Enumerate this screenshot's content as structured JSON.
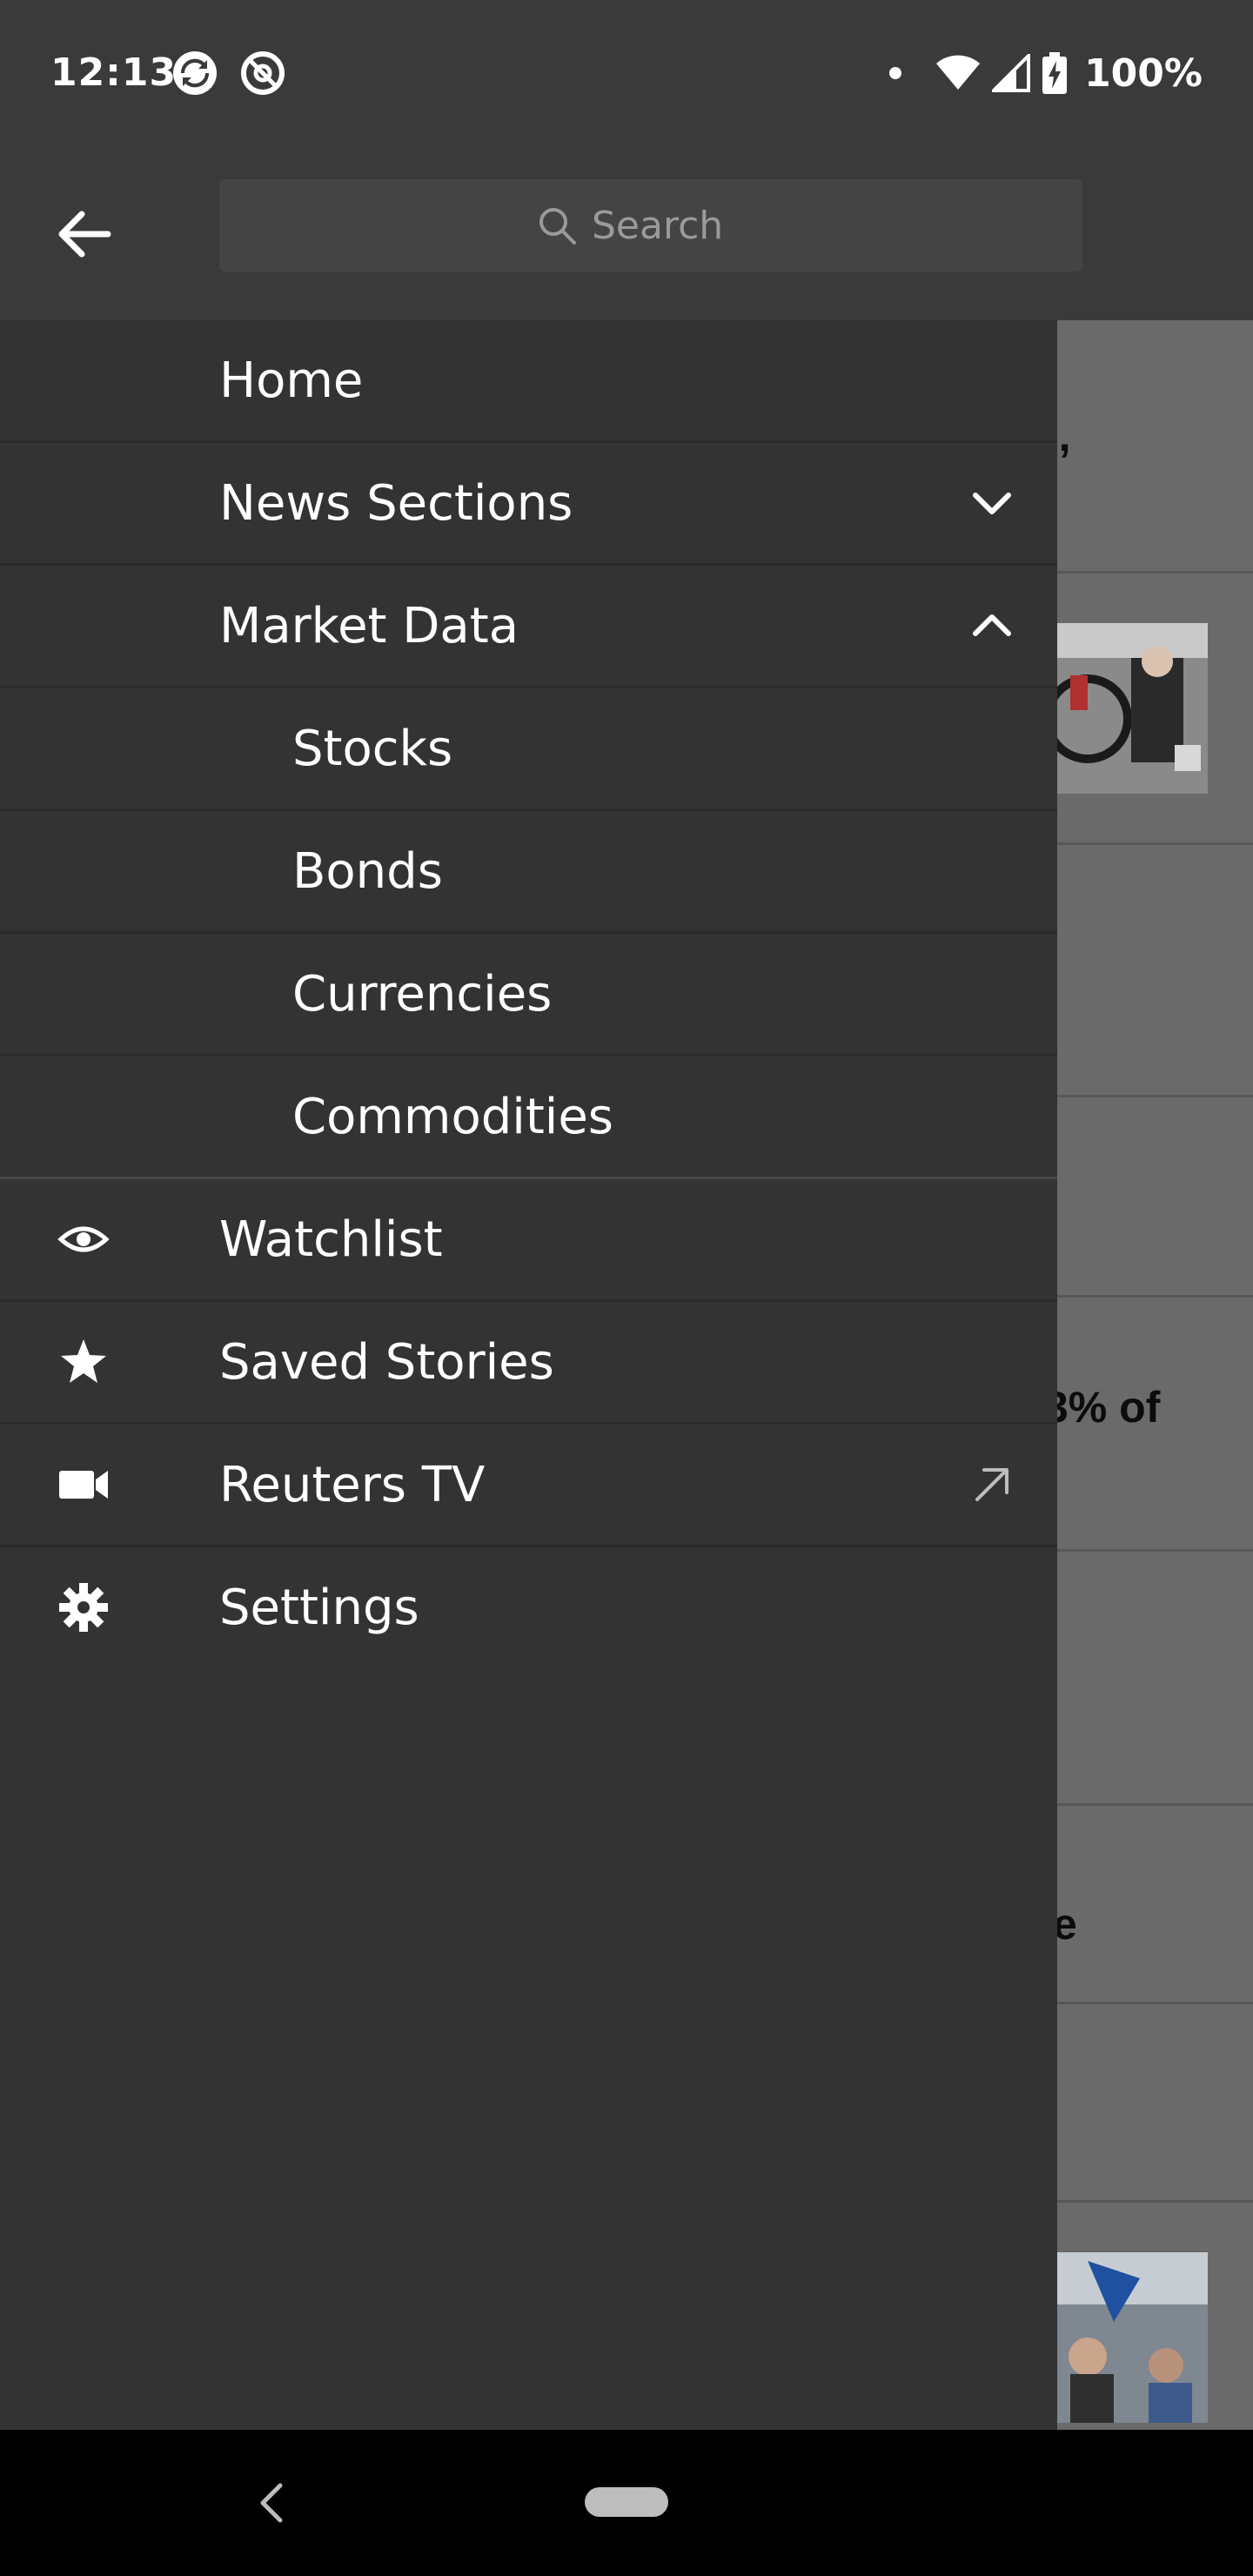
{
  "status_bar": {
    "time": "12:13",
    "battery": "100%",
    "icons": [
      "sync-app-icon",
      "at-sign-app-icon",
      "notification-dot",
      "wifi-icon",
      "signal-icon",
      "battery-charging-icon"
    ]
  },
  "search": {
    "placeholder": "Search"
  },
  "menu": {
    "home": "Home",
    "news_sections": "News Sections",
    "market_data": "Market Data",
    "stocks": "Stocks",
    "bonds": "Bonds",
    "currencies": "Currencies",
    "commodities": "Commodities",
    "watchlist": "Watchlist",
    "saved_stories": "Saved Stories",
    "reuters_tv": "Reuters TV",
    "settings": "Settings"
  },
  "background_text": {
    "fragment_1": "),",
    "fragment_2": "3% of",
    "fragment_3": "e"
  },
  "colors": {
    "drawer": "#333333",
    "header": "#3a3a3a",
    "scrim_page": "#6a6a6a"
  }
}
